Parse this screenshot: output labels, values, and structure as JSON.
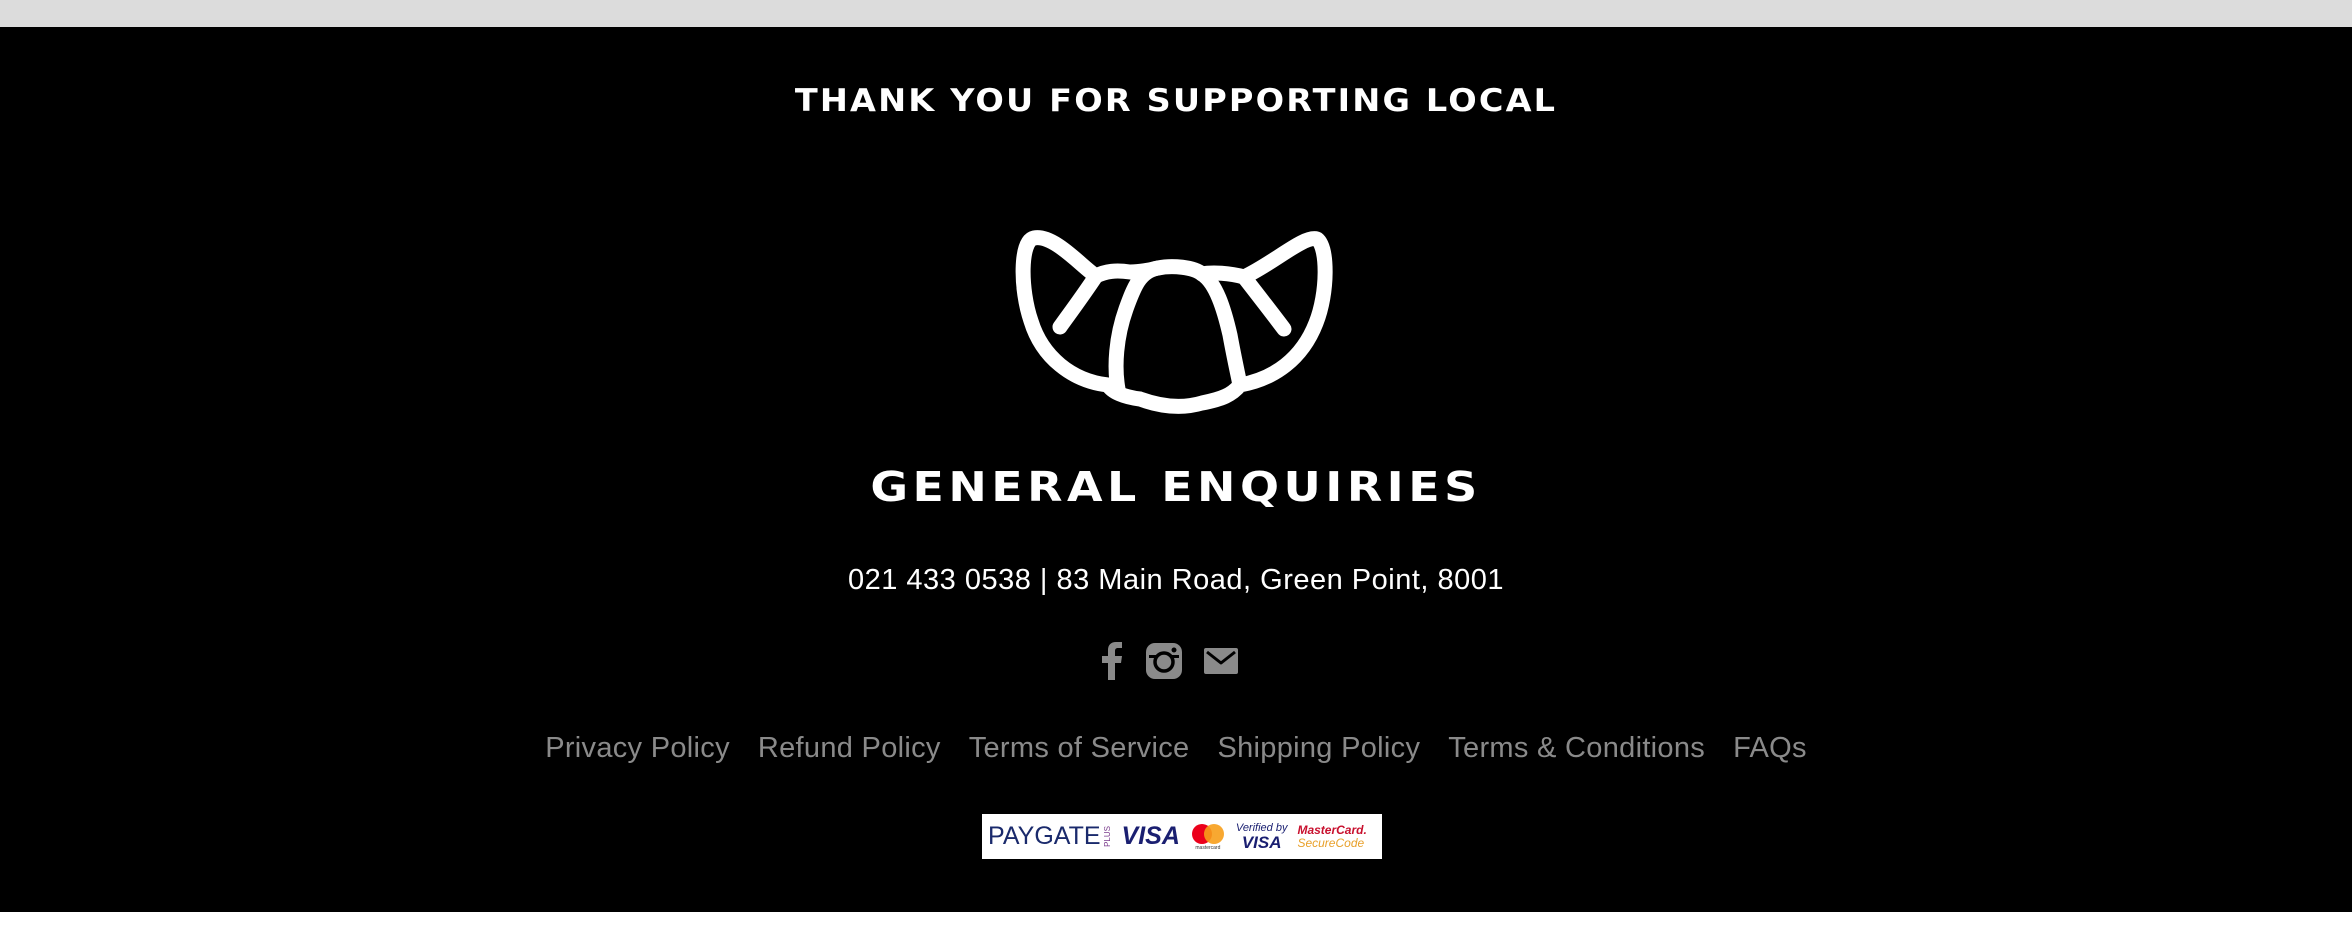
{
  "footer": {
    "tagline": "THANK YOU FOR SUPPORTING LOCAL",
    "logo_icon": "croissant-icon",
    "enquiries_title": "GENERAL ENQUIRIES",
    "contact_line": "021 433 0538 | 83 Main Road, Green Point, 8001",
    "socials": [
      {
        "icon": "facebook-icon"
      },
      {
        "icon": "instagram-icon"
      },
      {
        "icon": "mail-icon"
      }
    ],
    "policy_links": [
      "Privacy Policy",
      "Refund Policy",
      "Terms of Service",
      "Shipping Policy",
      "Terms & Conditions",
      "FAQs"
    ],
    "payment_badge": {
      "paygate": "PAYGATE",
      "paygate_plus": "PLUS",
      "visa": "VISA",
      "mastercard": "mastercard",
      "verified_by": "Verified by",
      "verified_visa": "VISA",
      "mastercard_securecode_top": "MasterCard.",
      "mastercard_securecode_bottom": "SecureCode"
    }
  },
  "colors": {
    "footer_bg": "#000000",
    "top_strip": "#dcdcdc",
    "text_primary": "#ffffff",
    "link_muted": "#8a8a8a",
    "social_icon": "#8a8a8a"
  }
}
